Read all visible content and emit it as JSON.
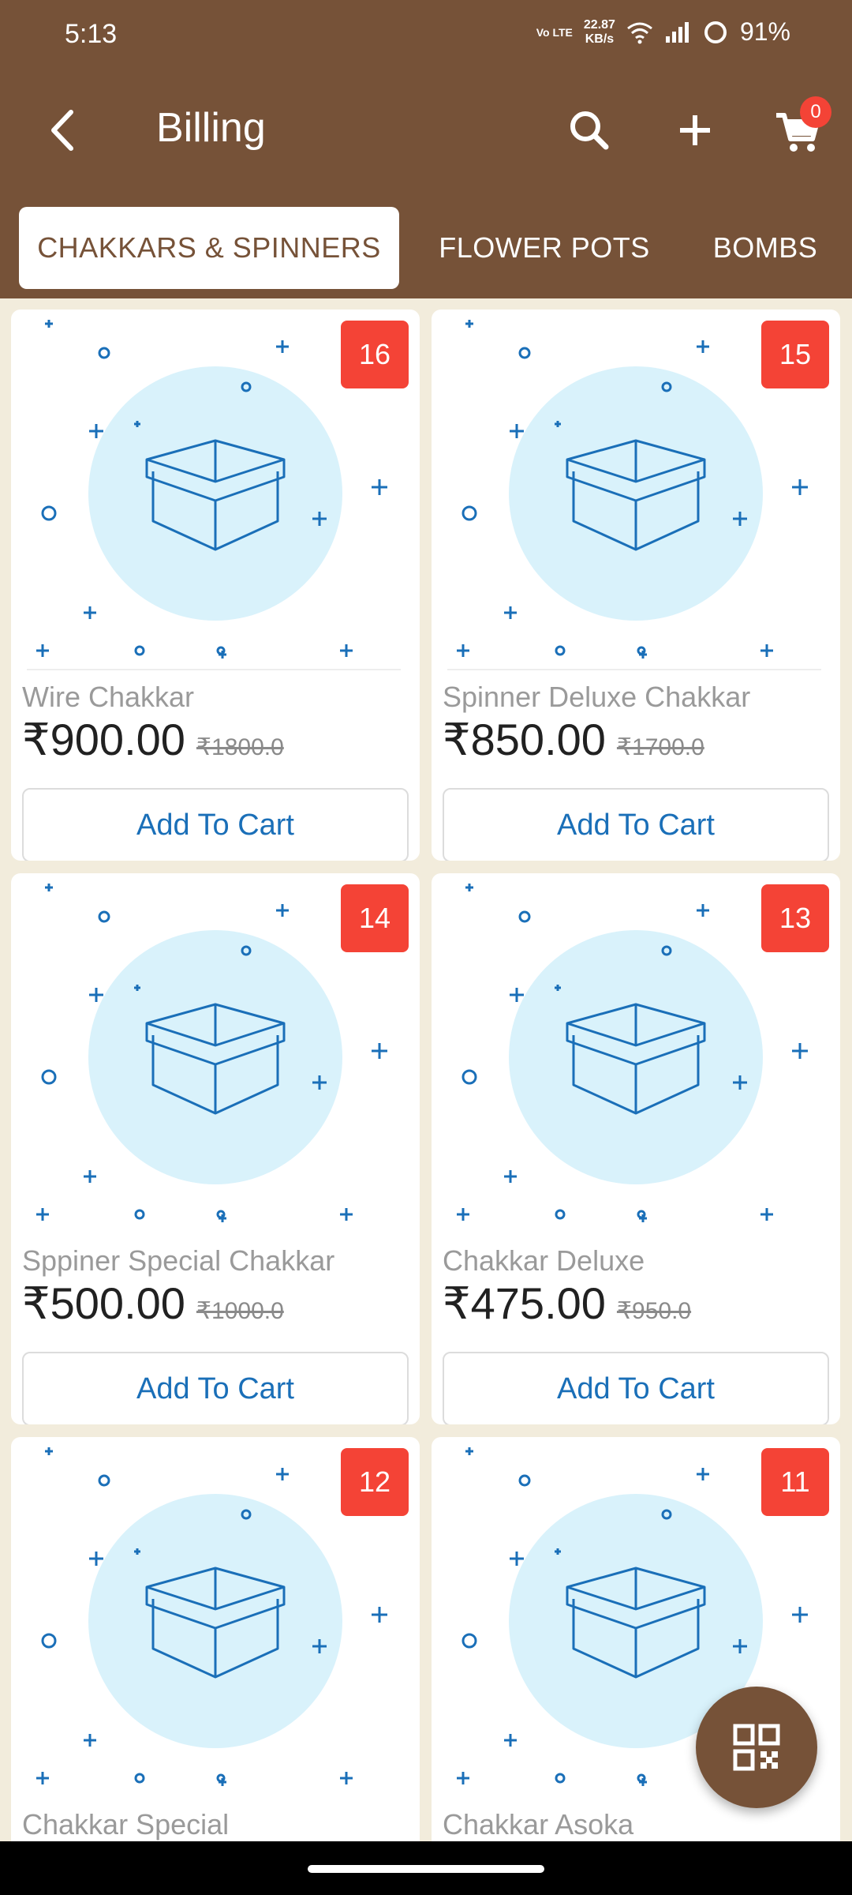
{
  "status_bar": {
    "time": "5:13",
    "volte": "Vo LTE",
    "speed_value": "22.87",
    "speed_unit": "KB/s",
    "battery": "91%"
  },
  "app_bar": {
    "title": "Billing",
    "cart_count": "0",
    "icons": [
      "back-arrow-icon",
      "search-icon",
      "plus-icon",
      "cart-icon"
    ]
  },
  "tabs": [
    {
      "label": "CHAKKARS & SPINNERS",
      "active": true
    },
    {
      "label": "FLOWER POTS",
      "active": false
    },
    {
      "label": "BOMBS",
      "active": false
    }
  ],
  "products": [
    {
      "badge": "16",
      "name": "Wire Chakkar",
      "price": "₹900.00",
      "mrp": "₹1800.0",
      "button": "Add To Cart"
    },
    {
      "badge": "15",
      "name": "Spinner Deluxe Chakkar",
      "price": "₹850.00",
      "mrp": "₹1700.0",
      "button": "Add To Cart"
    },
    {
      "badge": "14",
      "name": "Sppiner Special Chakkar",
      "price": "₹500.00",
      "mrp": "₹1000.0",
      "button": "Add To Cart"
    },
    {
      "badge": "13",
      "name": "Chakkar Deluxe",
      "price": "₹475.00",
      "mrp": "₹950.0",
      "button": "Add To Cart"
    },
    {
      "badge": "12",
      "name": "Chakkar Special",
      "price": "",
      "mrp": "",
      "button": ""
    },
    {
      "badge": "11",
      "name": "Chakkar Asoka",
      "price": "",
      "mrp": "",
      "button": ""
    }
  ],
  "colors": {
    "brand": "#765238",
    "badge": "#f44336",
    "accent_blue": "#1a6fb8",
    "placeholder_circle": "#d9f2fb",
    "background": "#f2ecdc"
  },
  "fab": {
    "icon": "qr-code-icon"
  }
}
